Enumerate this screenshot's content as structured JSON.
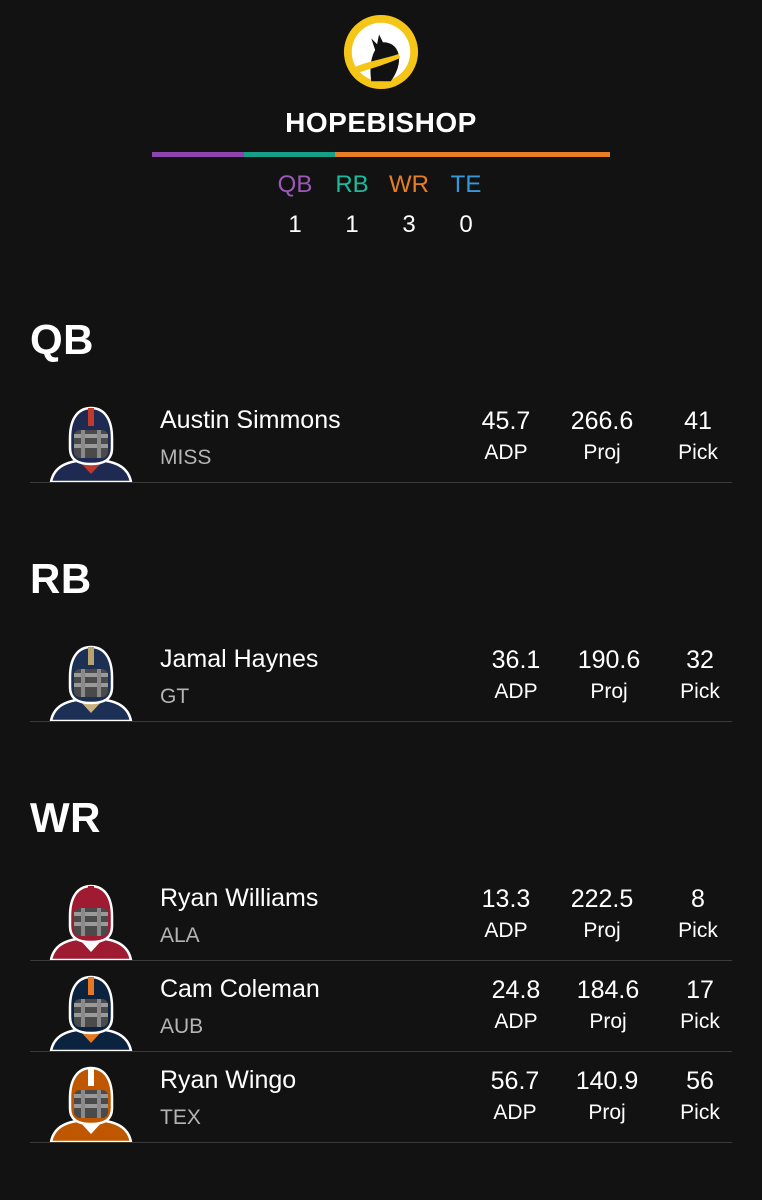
{
  "team": {
    "name": "HOPEBISHOP"
  },
  "position_bar": [
    {
      "pos": "QB",
      "color": "#8e44ad",
      "count": 1
    },
    {
      "pos": "RB",
      "color": "#16a085",
      "count": 1
    },
    {
      "pos": "WR",
      "color": "#e67e22",
      "count": 3
    },
    {
      "pos": "TE",
      "color": "#2e86c1",
      "count": 0
    }
  ],
  "counts": {
    "qb": {
      "label": "QB",
      "value": "1",
      "color": "#9b59b6"
    },
    "rb": {
      "label": "RB",
      "value": "1",
      "color": "#1abc9c"
    },
    "wr": {
      "label": "WR",
      "value": "3",
      "color": "#e67e22"
    },
    "te": {
      "label": "TE",
      "value": "0",
      "color": "#3498db"
    }
  },
  "stat_labels": {
    "adp": "ADP",
    "proj": "Proj",
    "pick": "Pick"
  },
  "sections": {
    "qb": {
      "title": "QB",
      "players": [
        {
          "name": "Austin Simmons",
          "team": "MISS",
          "adp": "45.7",
          "proj": "266.6",
          "pick": "41",
          "helmet_color": "#1f2a52",
          "stripe_color": "#c0392b",
          "jersey_color": "#1f2a52",
          "collar_color": "#c0392b"
        }
      ]
    },
    "rb": {
      "title": "RB",
      "players": [
        {
          "name": "Jamal Haynes",
          "team": "GT",
          "adp": "36.1",
          "proj": "190.6",
          "pick": "32",
          "helmet_color": "#1c2f55",
          "stripe_color": "#b7a36b",
          "jersey_color": "#1c2f55",
          "collar_color": "#c9b27c"
        }
      ]
    },
    "wr": {
      "title": "WR",
      "players": [
        {
          "name": "Ryan Williams",
          "team": "ALA",
          "adp": "13.3",
          "proj": "222.5",
          "pick": "8",
          "helmet_color": "#9e1b32",
          "stripe_color": "#9e1b32",
          "jersey_color": "#9e1b32",
          "collar_color": "#ffffff"
        },
        {
          "name": "Cam Coleman",
          "team": "AUB",
          "adp": "24.8",
          "proj": "184.6",
          "pick": "17",
          "helmet_color": "#0c2340",
          "stripe_color": "#e87722",
          "jersey_color": "#0c2340",
          "collar_color": "#e87722"
        },
        {
          "name": "Ryan Wingo",
          "team": "TEX",
          "adp": "56.7",
          "proj": "140.9",
          "pick": "56",
          "helmet_color": "#bf5700",
          "stripe_color": "#ffffff",
          "jersey_color": "#bf5700",
          "collar_color": "#ffffff"
        }
      ]
    }
  }
}
